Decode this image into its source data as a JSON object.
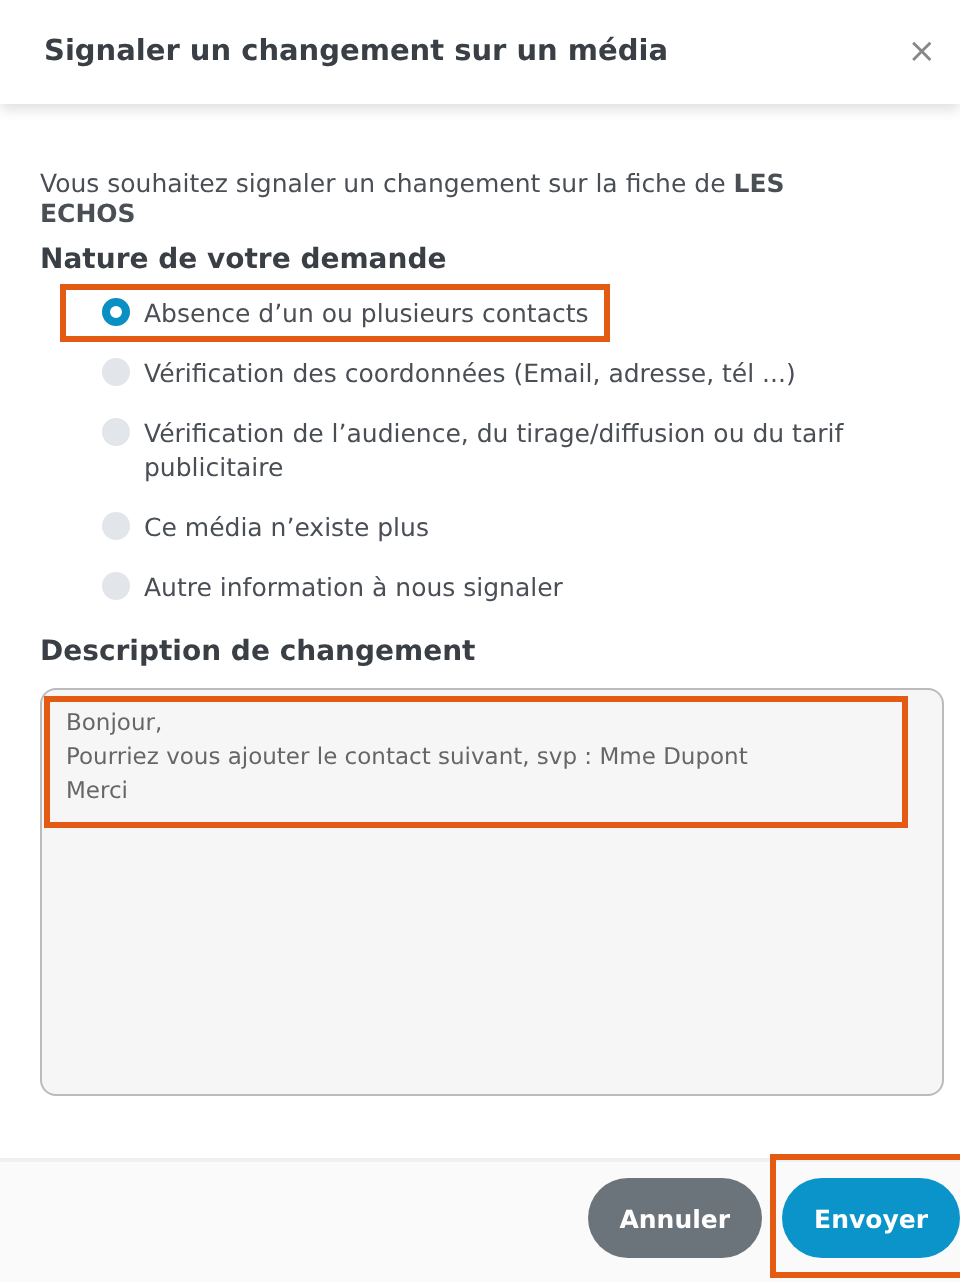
{
  "dialog": {
    "title": "Signaler un changement sur un média",
    "close": "×"
  },
  "intro": "Vous souhaitez signaler un changement sur la fiche de **LES ECHOS**",
  "nature": {
    "heading": "Nature de votre demande",
    "options": [
      {
        "label": "Absence d’un ou plusieurs contacts",
        "selected": true,
        "highlighted": true
      },
      {
        "label": "Vérification des coordonnées (Email, adresse, tél ...)",
        "selected": false,
        "highlighted": false
      },
      {
        "label": "Vérification de l’audience, du tirage/diffusion ou du tarif publicitaire",
        "selected": false,
        "highlighted": false
      },
      {
        "label": "Ce média n’existe plus",
        "selected": false,
        "highlighted": false
      },
      {
        "label": "Autre information à nous signaler",
        "selected": false,
        "highlighted": false
      }
    ]
  },
  "description": {
    "heading": "Description de changement",
    "value": "Bonjour,\nPourriez vous ajouter le contact suivant, svp : Mme Dupont\nMerci",
    "highlighted": true
  },
  "buttons": [
    {
      "label": "Annuler",
      "kind": "secondary",
      "highlighted": false
    },
    {
      "label": "Envoyer",
      "kind": "primary",
      "highlighted": true
    }
  ]
}
